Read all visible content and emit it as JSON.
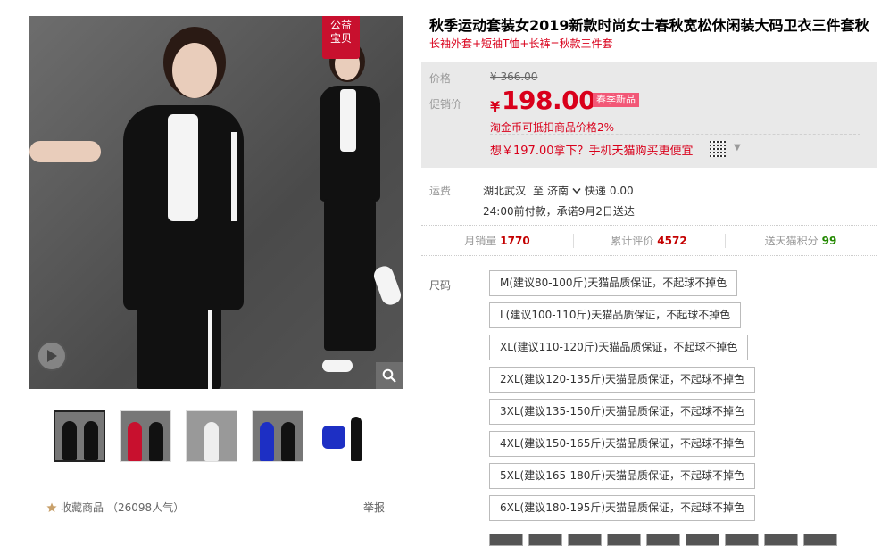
{
  "gallery": {
    "badge": [
      "公益",
      "宝贝"
    ],
    "thumbnail_count": 5,
    "favorite_label": "收藏商品",
    "favorite_count": "（26098人气）",
    "report_label": "举报",
    "icons": {
      "play": "play-icon",
      "zoom": "search-icon",
      "favorite": "star-icon"
    }
  },
  "product": {
    "title": "秋季运动套装女2019新款时尚女士春秋宽松休闲装大码卫衣三件套秋",
    "subtitle": "长袖外套+短袖T恤+长裤=秋款三件套"
  },
  "pricing": {
    "price_label": "价格",
    "original_price": "¥ 366.00",
    "promo_label": "促销价",
    "currency": "¥",
    "current_price": "198.00",
    "promo_tag": "春季新品",
    "coin_note": "淘金币可抵扣商品价格2%",
    "mobile_deal": "想￥197.00拿下？手机天猫购买更便宜",
    "icons": {
      "qr": "qr-code-icon",
      "chevron": "chevron-down-icon"
    }
  },
  "shipping": {
    "label": "运费",
    "origin": "湖北武汉",
    "to": "至",
    "destination": "济南",
    "method": "快递",
    "fee": "0.00",
    "promise": "24:00前付款，承诺9月2日送达"
  },
  "stats": [
    {
      "label": "月销量",
      "value": "1770"
    },
    {
      "label": "累计评价",
      "value": "4572"
    },
    {
      "label": "送天猫积分",
      "value": "99"
    }
  ],
  "sizes": {
    "label": "尺码",
    "options": [
      "M(建议80-100斤)天猫品质保证，不起球不掉色",
      "L(建议100-110斤)天猫品质保证，不起球不掉色",
      "XL(建议110-120斤)天猫品质保证，不起球不掉色",
      "2XL(建议120-135斤)天猫品质保证，不起球不掉色",
      "3XL(建议135-150斤)天猫品质保证，不起球不掉色",
      "4XL(建议150-165斤)天猫品质保证，不起球不掉色",
      "5XL(建议165-180斤)天猫品质保证，不起球不掉色",
      "6XL(建议180-195斤)天猫品质保证，不起球不掉色"
    ]
  },
  "colors": {
    "accent_red": "#d9001b",
    "badge_red": "#c8102e",
    "tag_pink": "#f25877",
    "points_green": "#228800",
    "price_bg": "#e9e9e9"
  }
}
